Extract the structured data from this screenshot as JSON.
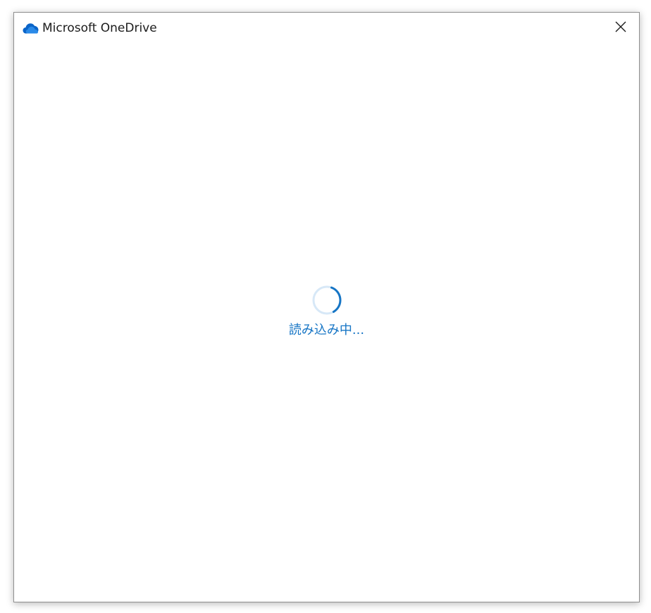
{
  "window": {
    "title": "Microsoft OneDrive",
    "icons": {
      "app_logo": "onedrive-cloud-icon",
      "close": "close-icon"
    }
  },
  "content": {
    "loading_text": "読み込み中..."
  },
  "colors": {
    "accent": "#1675c5",
    "spinner_track": "#d7e8f7",
    "logo_blue": "#0a64c8"
  }
}
